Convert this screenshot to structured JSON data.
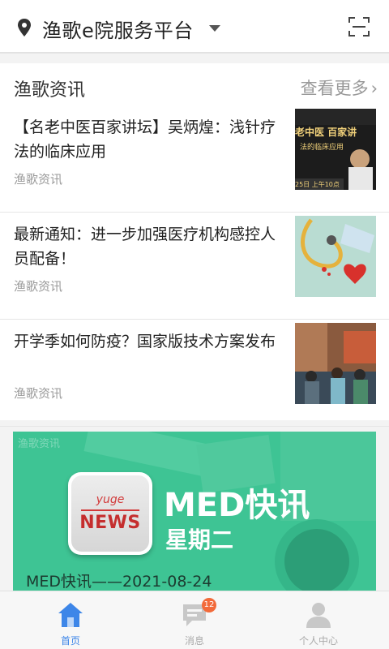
{
  "header": {
    "title": "渔歌e院服务平台"
  },
  "news": {
    "section_title": "渔歌资讯",
    "more_label": "查看更多",
    "items": [
      {
        "headline": "【名老中医百家讲坛】吴炳煌：浅针疗法的临床应用",
        "source": "渔歌资讯"
      },
      {
        "headline": "最新通知：进一步加强医疗机构感控人员配备！",
        "source": "渔歌资讯"
      },
      {
        "headline": "开学季如何防疫？国家版技术方案发布",
        "source": "渔歌资讯"
      }
    ],
    "thumb1_text": {
      "line1": "老中医  百家讲",
      "line2": "法的临床应用",
      "line3": "25日 上午10点"
    }
  },
  "banner": {
    "tag": "渔歌资讯",
    "logo_top": "yuge",
    "logo_bottom": "NEWS",
    "big_text": "MED快讯",
    "day_text": "星期二",
    "caption": "MED快讯——2021-08-24",
    "bg_color": "#3ec494"
  },
  "tabbar": {
    "tabs": [
      {
        "label": "首页",
        "icon": "home-icon",
        "active": true
      },
      {
        "label": "消息",
        "icon": "message-icon",
        "badge": "12"
      },
      {
        "label": "个人中心",
        "icon": "person-icon"
      }
    ],
    "active_color": "#3d86e8"
  }
}
